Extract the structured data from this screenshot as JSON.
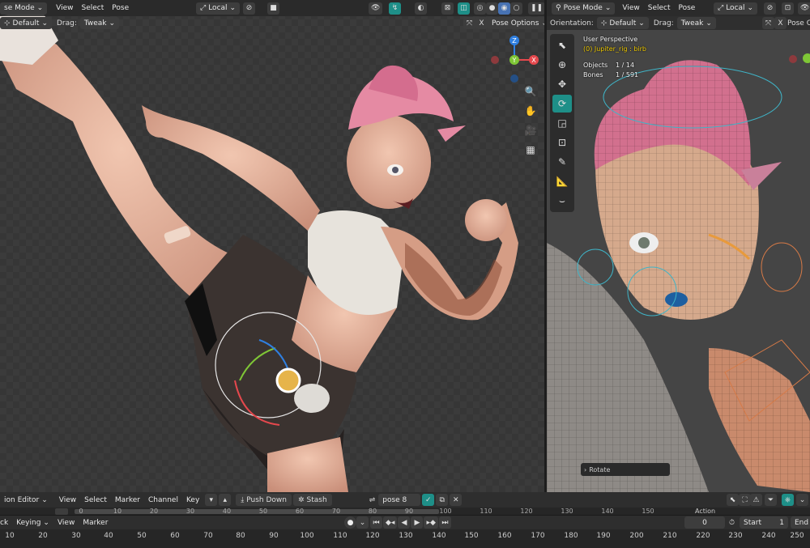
{
  "left_header": {
    "mode": "se Mode",
    "menus": [
      "View",
      "Select",
      "Pose"
    ],
    "pivot": "Local"
  },
  "left_subheader": {
    "orientation_value": "Default",
    "drag_label": "Drag:",
    "drag_value": "Tweak",
    "pose_options": "Pose Options"
  },
  "right_header": {
    "mode": "Pose Mode",
    "menus": [
      "View",
      "Select",
      "Pose"
    ],
    "pivot": "Local"
  },
  "right_subheader": {
    "orientation_label": "Orientation:",
    "orientation_value": "Default",
    "drag_label": "Drag:",
    "drag_value": "Tweak",
    "pose_options": "Pose Op"
  },
  "overlay_info": {
    "view_name": "User Perspective",
    "object_name": "(0) Jupiter_rig : birb",
    "objects_label": "Objects",
    "objects_value": "1 / 14",
    "bones_label": "Bones",
    "bones_value": "1 / 591"
  },
  "last_operator": "Rotate",
  "gizmo_axes": {
    "x": "X",
    "y": "Y",
    "z": "Z"
  },
  "action_editor": {
    "editor_name": "ion Editor",
    "menus": [
      "View",
      "Select",
      "Marker",
      "Channel",
      "Key"
    ],
    "push_down": "Push Down",
    "stash": "Stash",
    "action_name": "pose 8",
    "ruler": [
      "0",
      "10",
      "20",
      "30",
      "40",
      "50",
      "60",
      "70",
      "80",
      "90",
      "100",
      "110",
      "120",
      "130",
      "140",
      "150"
    ],
    "ruler_right": "Action"
  },
  "timeline": {
    "menus": [
      "ck",
      "Keying",
      "View",
      "Marker"
    ],
    "current_frame": "0",
    "start_label": "Start",
    "start_value": "1",
    "end_label": "End",
    "frames": [
      "10",
      "20",
      "30",
      "40",
      "50",
      "60",
      "70",
      "80",
      "90",
      "100",
      "110",
      "120",
      "130",
      "140",
      "150",
      "160",
      "170",
      "180",
      "190",
      "200",
      "210",
      "220",
      "230",
      "240",
      "250"
    ]
  },
  "colors": {
    "accent": "#4772b3",
    "active_tool": "#1e8f88",
    "object_name": "#e8c400",
    "axis_x": "#e5484d",
    "axis_y": "#7fc636",
    "axis_z": "#2f7fe0"
  }
}
